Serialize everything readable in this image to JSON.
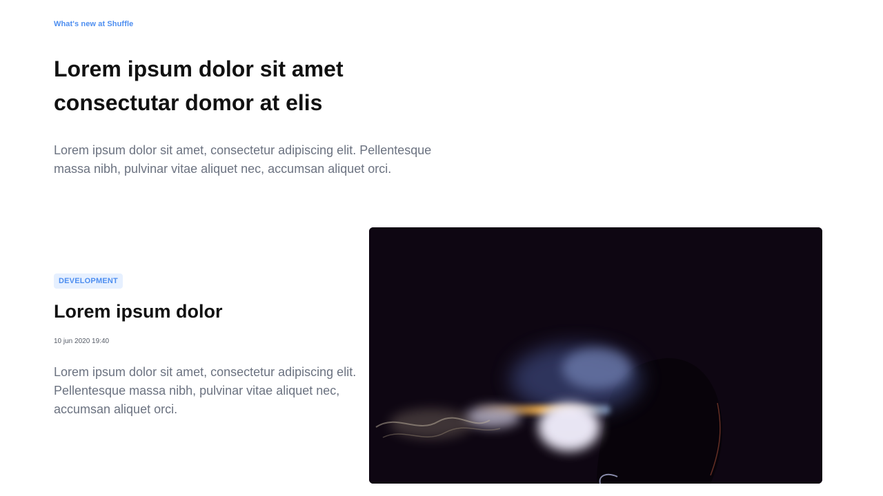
{
  "header": {
    "kicker": "What's new at Shuffle",
    "title": "Lorem ipsum dolor sit amet consectutar domor at elis",
    "description": "Lorem ipsum dolor sit amet, consectetur adipiscing elit. Pellentesque massa nibh, pulvinar vitae aliquet nec, accumsan aliquet orci."
  },
  "post": {
    "category": "DEVELOPMENT",
    "title": "Lorem ipsum dolor",
    "date": "10 jun 2020 19:40",
    "excerpt": "Lorem ipsum dolor sit amet, consectetur adipiscing elit. Pellentesque massa nibh, pulvinar vitae aliquet nec, accumsan aliquet orci."
  },
  "colors": {
    "accent": "#4d8ef0",
    "badge_bg": "#e6f0ff",
    "heading": "#111111",
    "body_text": "#6b7280",
    "photo_bg": "#0e0612"
  }
}
